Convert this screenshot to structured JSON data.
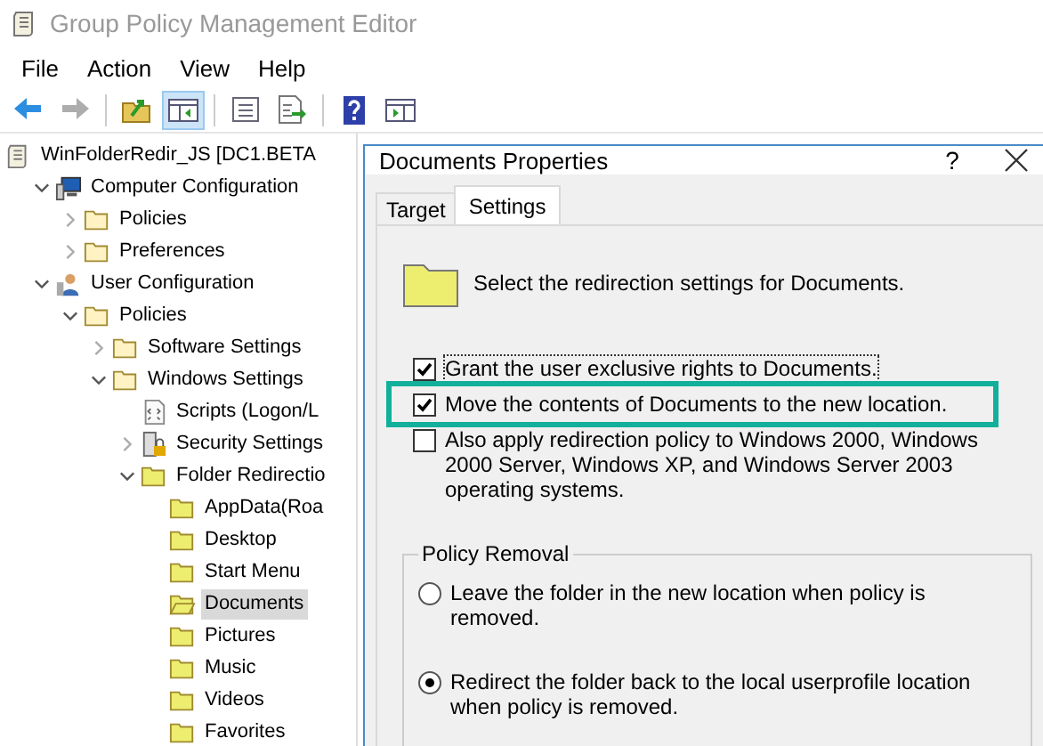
{
  "window": {
    "title": "Group Policy Management Editor"
  },
  "menu": [
    "File",
    "Action",
    "View",
    "Help"
  ],
  "toolbar": [
    {
      "kind": "back",
      "disabled": false
    },
    {
      "kind": "forward",
      "disabled": true
    },
    {
      "kind": "up",
      "disabled": false
    },
    {
      "kind": "tree",
      "pressed": true
    },
    {
      "kind": "properties",
      "disabled": false
    },
    {
      "kind": "export",
      "disabled": false
    },
    {
      "kind": "help",
      "disabled": false
    },
    {
      "kind": "panel",
      "disabled": false
    }
  ],
  "tree": [
    {
      "label": "WinFolderRedir_JS [DC1.BETA",
      "kind": "script",
      "selected": false,
      "children": [
        {
          "label": "Computer Configuration",
          "kind": "computer",
          "expanded": true,
          "selected": false,
          "children": [
            {
              "label": "Policies",
              "kind": "folder",
              "expanded": false,
              "selected": false
            },
            {
              "label": "Preferences",
              "kind": "folder",
              "expanded": false,
              "selected": false
            }
          ]
        },
        {
          "label": "User Configuration",
          "kind": "user",
          "expanded": true,
          "selected": false,
          "children": [
            {
              "label": "Policies",
              "kind": "folder",
              "expanded": true,
              "selected": false,
              "children": [
                {
                  "label": "Software Settings",
                  "kind": "folder",
                  "expanded": false,
                  "selected": false
                },
                {
                  "label": "Windows Settings",
                  "kind": "folder",
                  "expanded": true,
                  "selected": false,
                  "children": [
                    {
                      "label": "Scripts (Logon/L",
                      "kind": "script-file",
                      "selected": false
                    },
                    {
                      "label": "Security Settings",
                      "kind": "security",
                      "expanded": false,
                      "selected": false
                    },
                    {
                      "label": "Folder Redirectio",
                      "kind": "folder-yellow",
                      "expanded": true,
                      "selected": false,
                      "children": [
                        {
                          "label": "AppData(Roa",
                          "kind": "folder-yellow",
                          "selected": false
                        },
                        {
                          "label": "Desktop",
                          "kind": "folder-yellow",
                          "selected": false
                        },
                        {
                          "label": "Start Menu",
                          "kind": "folder-yellow",
                          "selected": false
                        },
                        {
                          "label": "Documents",
                          "kind": "folder-open",
                          "selected": true
                        },
                        {
                          "label": "Pictures",
                          "kind": "folder-yellow",
                          "selected": false
                        },
                        {
                          "label": "Music",
                          "kind": "folder-yellow",
                          "selected": false
                        },
                        {
                          "label": "Videos",
                          "kind": "folder-yellow",
                          "selected": false
                        },
                        {
                          "label": "Favorites",
                          "kind": "folder-yellow",
                          "selected": false
                        }
                      ]
                    }
                  ]
                }
              ]
            }
          ]
        }
      ]
    }
  ],
  "dialog": {
    "title": "Documents Properties",
    "help": "?",
    "tabs": [
      {
        "label": "Target",
        "selected": false
      },
      {
        "label": "Settings",
        "selected": true
      }
    ],
    "heading": "Select the redirection settings for Documents.",
    "options": [
      {
        "label": "Grant the user exclusive rights to Documents.",
        "checked": true,
        "focused": true,
        "highlighted": false
      },
      {
        "label": "Move the contents of Documents to the new location.",
        "checked": true,
        "focused": false,
        "highlighted": true
      },
      {
        "label": "Also apply redirection policy to Windows 2000, Windows 2000 Server, Windows XP, and Windows Server 2003 operating systems.",
        "checked": false,
        "focused": false,
        "highlighted": false
      }
    ],
    "policy_removal": {
      "title": "Policy Removal",
      "options": [
        {
          "label": "Leave the folder in the new location when policy is removed.",
          "selected": false
        },
        {
          "label": "Redirect the folder back to the local userprofile location when policy is removed.",
          "selected": true
        }
      ]
    }
  }
}
